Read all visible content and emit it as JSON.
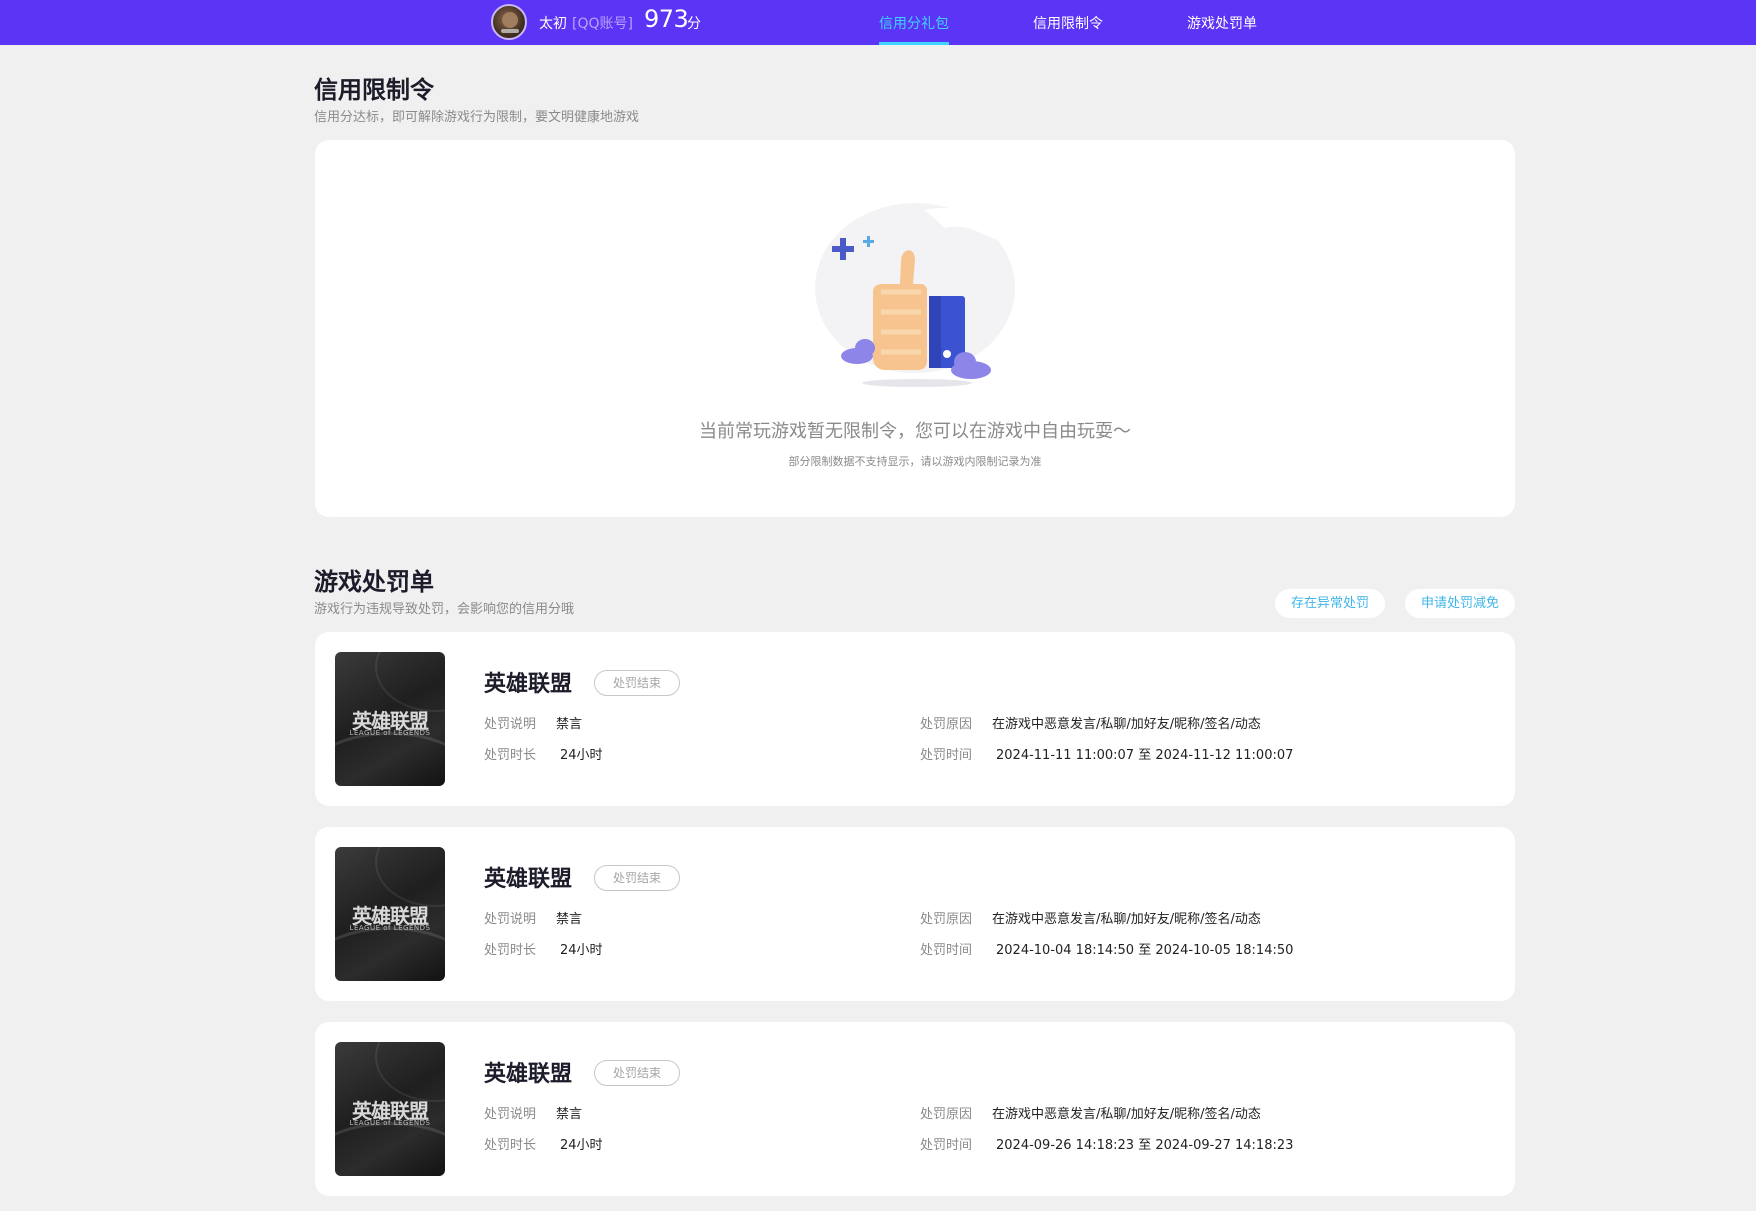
{
  "header": {
    "username": "太初",
    "account_type": "[QQ账号]",
    "score": "973",
    "score_unit": "分",
    "nav": [
      {
        "label": "信用分礼包",
        "active": true
      },
      {
        "label": "信用限制令",
        "active": false
      },
      {
        "label": "游戏处罚单",
        "active": false
      }
    ]
  },
  "restrictions": {
    "title": "信用限制令",
    "subtitle": "信用分达标，即可解除游戏行为限制，要文明健康地游戏",
    "empty_message": "当前常玩游戏暂无限制令，您可以在游戏中自由玩耍～",
    "empty_note": "部分限制数据不支持显示，请以游戏内限制记录为准"
  },
  "penalties": {
    "title": "游戏处罚单",
    "subtitle": "游戏行为违规导致处罚，会影响您的信用分哦",
    "buttons": {
      "report_abnormal": "存在异常处罚",
      "apply_reduction": "申请处罚减免"
    },
    "labels": {
      "desc": "处罚说明",
      "duration": "处罚时长",
      "reason": "处罚原因",
      "time": "处罚时间"
    },
    "game_logo_cn": "英雄联盟",
    "game_logo_en": "LEAGUE of LEGENDS",
    "items": [
      {
        "game": "英雄联盟",
        "status": "处罚结束",
        "desc": "禁言",
        "duration": "24小时",
        "reason": "在游戏中恶意发言/私聊/加好友/昵称/签名/动态",
        "time": "2024-11-11 11:00:07 至 2024-11-12 11:00:07"
      },
      {
        "game": "英雄联盟",
        "status": "处罚结束",
        "desc": "禁言",
        "duration": "24小时",
        "reason": "在游戏中恶意发言/私聊/加好友/昵称/签名/动态",
        "time": "2024-10-04 18:14:50 至 2024-10-05 18:14:50"
      },
      {
        "game": "英雄联盟",
        "status": "处罚结束",
        "desc": "禁言",
        "duration": "24小时",
        "reason": "在游戏中恶意发言/私聊/加好友/昵称/签名/动态",
        "time": "2024-09-26 14:18:23 至 2024-09-27 14:18:23"
      }
    ]
  },
  "colors": {
    "topbar": "#5b34f5",
    "accent": "#3fd3ff",
    "link": "#3fb6ea"
  }
}
